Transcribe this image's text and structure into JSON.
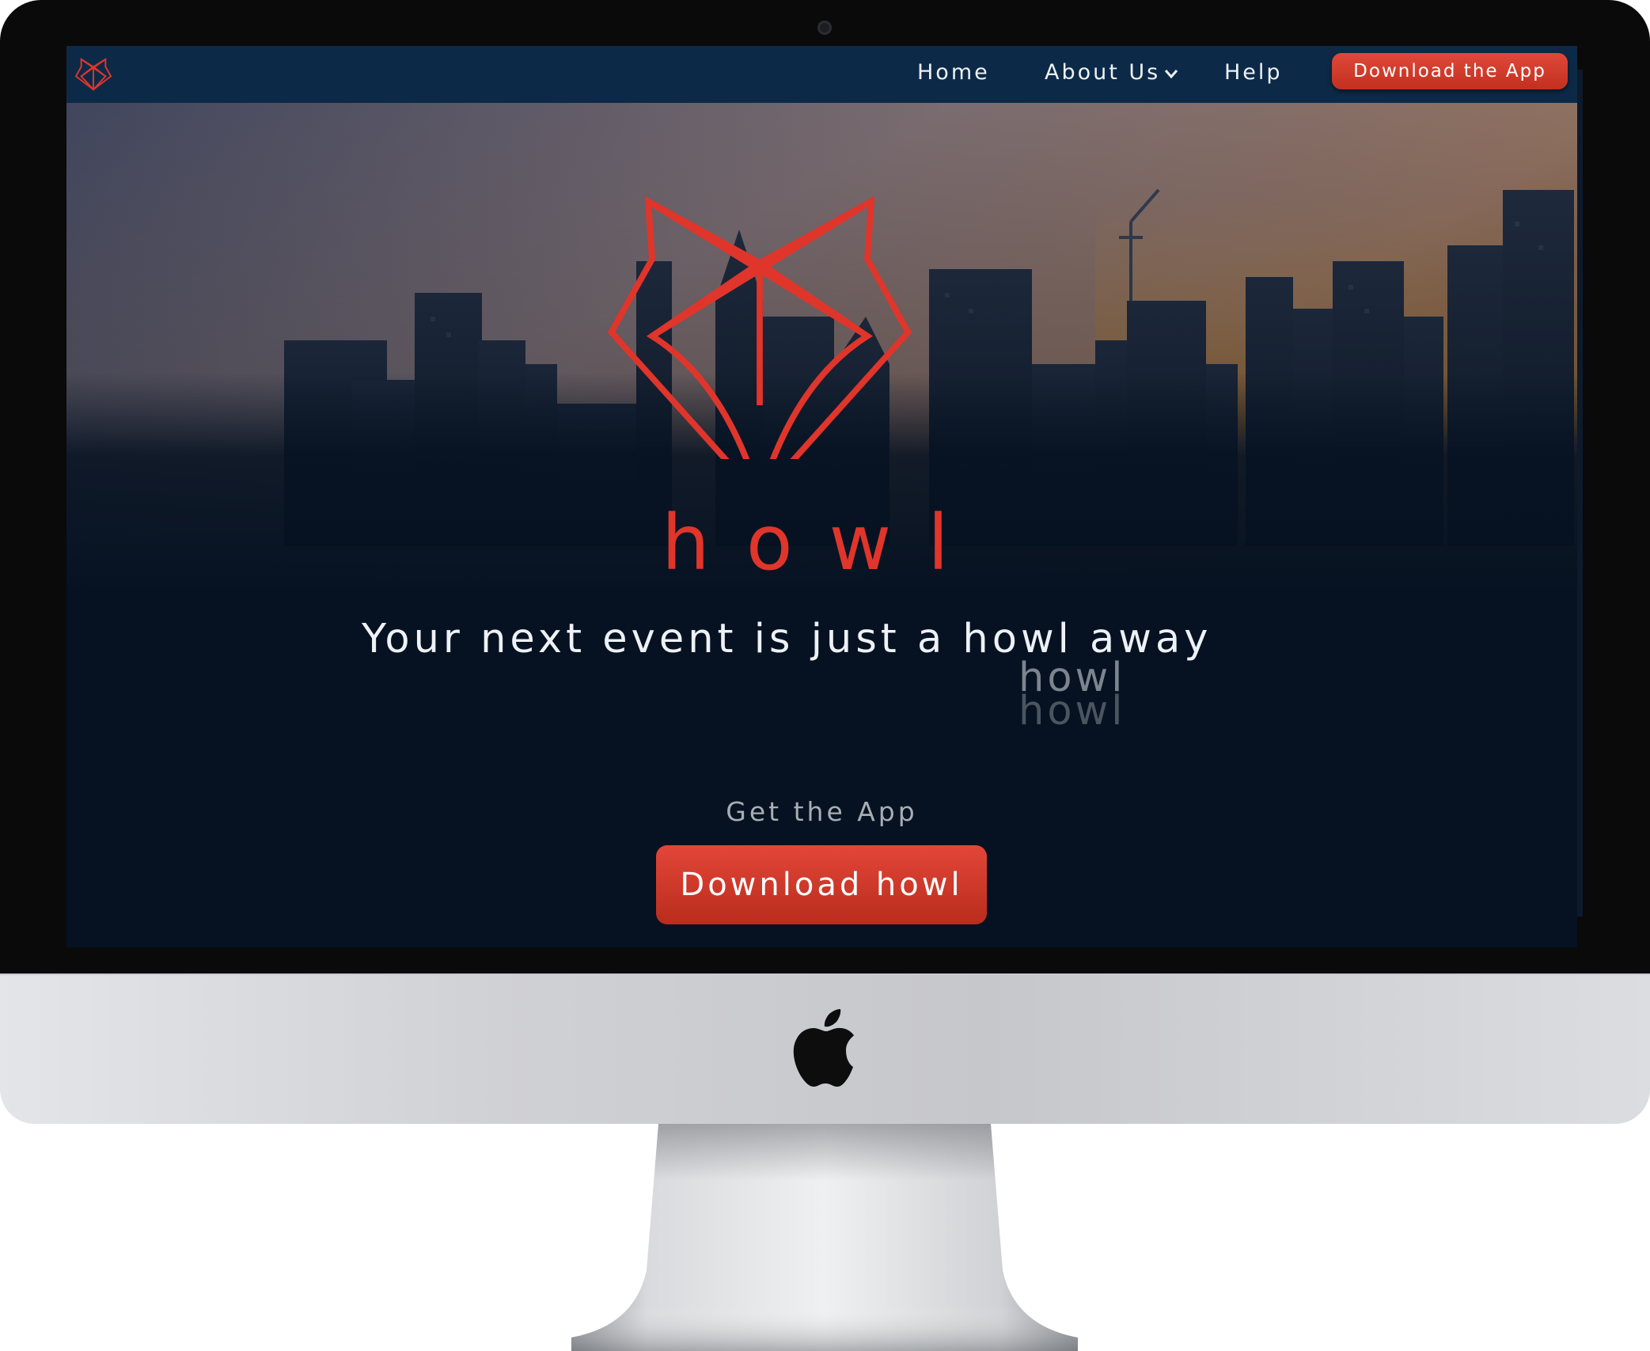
{
  "nav": {
    "home_label": "Home",
    "about_label": "About Us",
    "help_label": "Help",
    "cta_label": "Download the App"
  },
  "hero": {
    "brand_name": "howl",
    "tagline": "Your next event is just a howl away",
    "tagline_echo_1": "howl",
    "tagline_echo_2": "howl",
    "get_app_label": "Get the App",
    "cta_label": "Download howl"
  },
  "icons": {
    "nav_logo": "fox-logo-icon",
    "brand_logo": "fox-logo-icon",
    "about_chevron": "chevron-down-icon",
    "device_logo": "apple-logo-icon"
  },
  "colors": {
    "accent_red": "#e0352b",
    "navbar": "#0c2a47",
    "page_bg": "#061222",
    "text_light": "#eef1f5"
  }
}
